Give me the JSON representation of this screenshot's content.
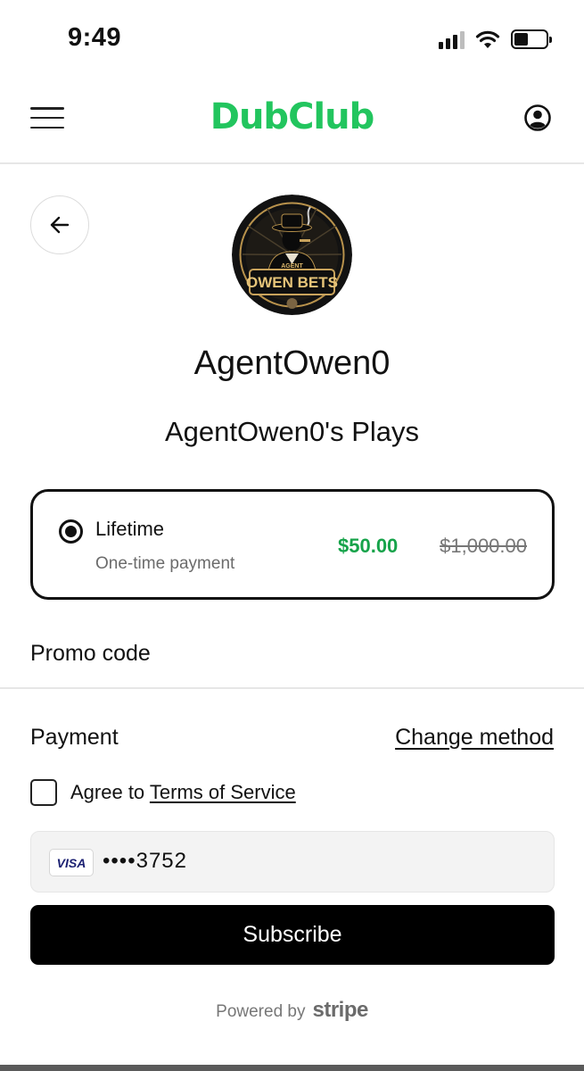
{
  "status_bar": {
    "time": "9:49",
    "battery_level": 0.45
  },
  "header": {
    "logo_text": "DubClub",
    "logo_color": "#22c55e"
  },
  "creator": {
    "name": "AgentOwen0",
    "product_title": "AgentOwen0's Plays",
    "avatar": {
      "top_text": "AGENT",
      "main_text": "OWEN BETS"
    }
  },
  "plan": {
    "title": "Lifetime",
    "subtitle": "One-time payment",
    "price": "$50.00",
    "original_price": "$1,000.00",
    "selected": true,
    "price_color": "#16a34a"
  },
  "promo": {
    "label": "Promo code"
  },
  "payment": {
    "label": "Payment",
    "change_method": "Change method",
    "terms_prefix": "Agree to",
    "terms_link": "Terms of Service",
    "terms_checked": false,
    "card_brand": "VISA",
    "card_number": "••••3752"
  },
  "subscribe_label": "Subscribe",
  "footer": {
    "powered_by": "Powered by",
    "stripe": "stripe"
  }
}
